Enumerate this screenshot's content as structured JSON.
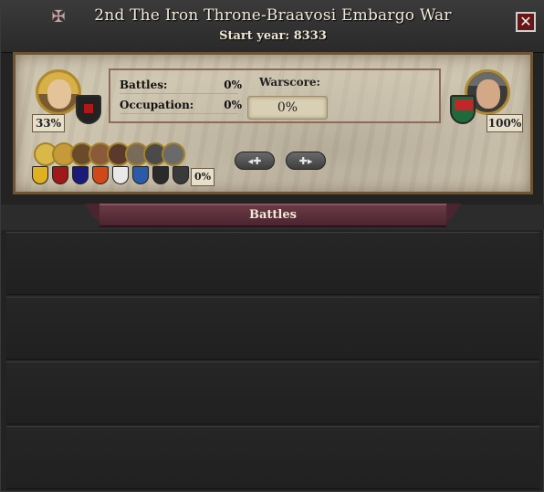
{
  "window": {
    "title": "2nd The Iron Throne-Braavosi Embargo War",
    "start_year_text": "Start year: 8333",
    "close_label": "✕"
  },
  "attacker": {
    "percent": "33%"
  },
  "defender": {
    "percent": "100%"
  },
  "stats": {
    "battles_label": "Battles:",
    "battles_value": "0%",
    "occupation_label": "Occupation:",
    "occupation_value": "0%"
  },
  "warscore": {
    "label": "Warscore:",
    "value": "0%"
  },
  "allies": {
    "percent": "0%"
  },
  "battles_section": {
    "header": "Battles",
    "rows": 4
  },
  "colors": {
    "accent_ribbon": "#5a2d38",
    "parchment": "#cfc6b1",
    "background": "#232323"
  },
  "icons": {
    "war": "cross-swords-icon",
    "close": "close-icon",
    "prev": "prev-arrows-icon",
    "next": "next-arrows-icon"
  }
}
